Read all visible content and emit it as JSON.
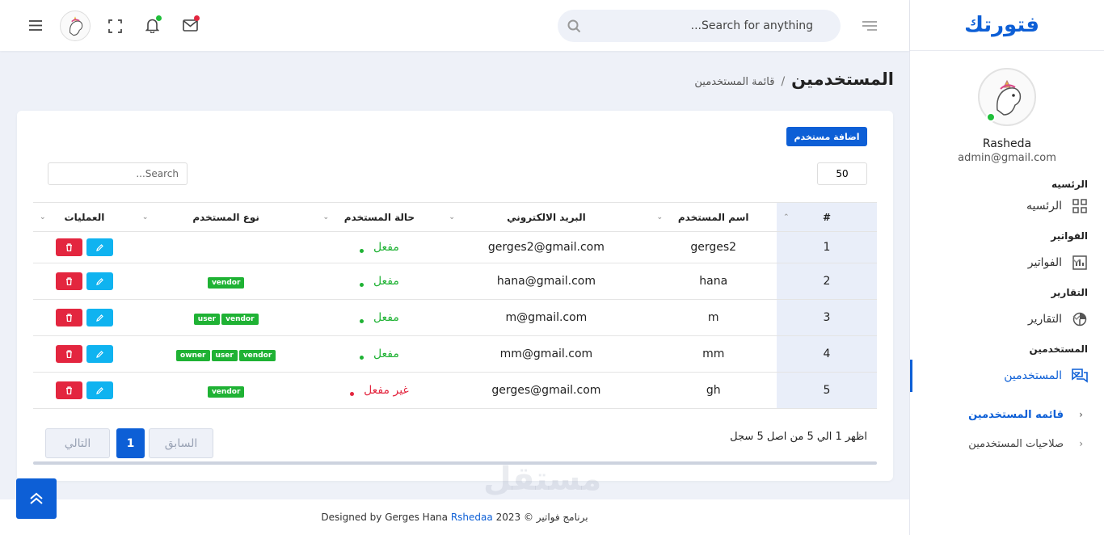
{
  "brand": "فتورتك",
  "search": {
    "placeholder": "Search for anything..."
  },
  "profile": {
    "name": "Rasheda",
    "email": "admin@gmail.com"
  },
  "sidebar": {
    "sections": [
      {
        "title": "الرئسيه",
        "item": "الرئسيه",
        "icon": "grid-icon"
      },
      {
        "title": "الفواتير",
        "item": "الفواتير",
        "icon": "bar-chart-icon"
      },
      {
        "title": "التقارير",
        "item": "التقارير",
        "icon": "pie-chart-icon"
      },
      {
        "title": "المستخدمين",
        "item": "المستخدمين",
        "icon": "chat-icon"
      }
    ],
    "sub_items": [
      "قائمه المستخدمين",
      "صلاحيات المستخدمين"
    ]
  },
  "page": {
    "title": "المستخدمين",
    "breadcrumb": "قائمة المستخدمين",
    "separator": "/"
  },
  "card": {
    "add_button": "اضافة مستخدم",
    "page_length": "50",
    "search_placeholder": "Search...",
    "columns": [
      "#",
      "اسم المستخدم",
      "البريد الالكتروني",
      "حالة المستخدم",
      "نوع المستخدم",
      "العمليات"
    ],
    "rows": [
      {
        "idx": "1",
        "name": "gerges2",
        "email": "gerges2@gmail.com",
        "status": "مفعل",
        "active": true,
        "roles": []
      },
      {
        "idx": "2",
        "name": "hana",
        "email": "hana@gmail.com",
        "status": "مفعل",
        "active": true,
        "roles": [
          "vendor"
        ]
      },
      {
        "idx": "3",
        "name": "m",
        "email": "m@gmail.com",
        "status": "مفعل",
        "active": true,
        "roles": [
          "vendor",
          "user"
        ]
      },
      {
        "idx": "4",
        "name": "mm",
        "email": "mm@gmail.com",
        "status": "مفعل",
        "active": true,
        "roles": [
          "vendor",
          "user",
          "owner"
        ]
      },
      {
        "idx": "5",
        "name": "gh",
        "email": "gerges@gmail.com",
        "status": "غير مفعل",
        "active": false,
        "roles": [
          "vendor"
        ]
      }
    ],
    "info": "اظهر 1 الي 5 من اصل 5 سجل",
    "pagination": {
      "prev": "السابق",
      "current": "1",
      "next": "التالي"
    }
  },
  "footer": {
    "text": "برنامج فواتير © 2023 Designed by Gerges Hana",
    "link": "Rshedaa"
  },
  "watermark": "مستقل",
  "colors": {
    "primary": "#0d5fd6",
    "success": "#1fb234",
    "danger": "#e3263f",
    "info": "#0fb3f0"
  }
}
